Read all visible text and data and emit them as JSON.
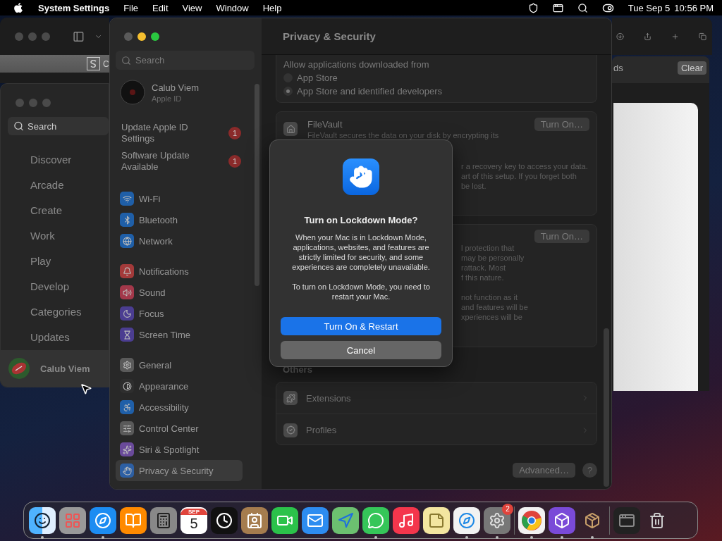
{
  "menu_bar": {
    "app": "System Settings",
    "menus": [
      "File",
      "Edit",
      "View",
      "Window",
      "Help"
    ],
    "date": "Tue Sep 5",
    "time": "10:56 PM"
  },
  "safari": {
    "tab_fragment": "C",
    "downloads": {
      "title_fragment": "ds",
      "clear": "Clear"
    }
  },
  "app_store": {
    "search": {
      "placeholder": "Search"
    },
    "items": [
      "Discover",
      "Arcade",
      "Create",
      "Work",
      "Play",
      "Develop",
      "Categories",
      "Updates"
    ],
    "account": "Calub Viem"
  },
  "settings": {
    "search": {
      "placeholder": "Search"
    },
    "account": {
      "name": "Calub Viem",
      "subtitle": "Apple ID"
    },
    "alerts": [
      {
        "label": "Update Apple ID Settings",
        "badge": "1"
      },
      {
        "label": "Software Update Available",
        "badge": "1"
      }
    ],
    "groups": [
      [
        {
          "label": "Wi-Fi",
          "color": "#1f5fa8",
          "selected": false
        },
        {
          "label": "Bluetooth",
          "color": "#1f5fa8",
          "selected": false
        },
        {
          "label": "Network",
          "color": "#1f5fa8",
          "selected": false
        }
      ],
      [
        {
          "label": "Notifications",
          "color": "#a33a3a",
          "selected": false
        },
        {
          "label": "Sound",
          "color": "#a3384a",
          "selected": false
        },
        {
          "label": "Focus",
          "color": "#4b3d91",
          "selected": false
        },
        {
          "label": "Screen Time",
          "color": "#4b3d91",
          "selected": false
        }
      ],
      [
        {
          "label": "General",
          "color": "#5a5a5a",
          "selected": false
        },
        {
          "label": "Appearance",
          "color": "#2e2e2e",
          "selected": false
        },
        {
          "label": "Accessibility",
          "color": "#1f5fa8",
          "selected": false
        },
        {
          "label": "Control Center",
          "color": "#5a5a5a",
          "selected": false
        },
        {
          "label": "Siri & Spotlight",
          "color": "#6a4a9a",
          "selected": false
        },
        {
          "label": "Privacy & Security",
          "color": "#2d5fa3",
          "selected": true
        }
      ]
    ],
    "title": "Privacy & Security",
    "allow": {
      "heading": "Allow applications downloaded from",
      "options": [
        {
          "label": "App Store",
          "selected": false
        },
        {
          "label": "App Store and identified developers",
          "selected": true
        }
      ]
    },
    "filevault": {
      "title": "FileVault",
      "button": "Turn On…",
      "description": "FileVault secures the data on your disk by encrypting its",
      "fragments": [
        "r a recovery key to access your data.",
        "art of this setup. If you forget both",
        "be lost."
      ]
    },
    "lockdown": {
      "button": "Turn On…",
      "fragment_groups": [
        [
          "l protection that",
          "may be personally",
          "rattack. Most",
          "f this nature."
        ],
        [
          "not function as it",
          "and features will be",
          "xperiences will be"
        ]
      ]
    },
    "others": {
      "heading": "Others",
      "items": [
        {
          "label": "Extensions",
          "kind": "extensions"
        },
        {
          "label": "Profiles",
          "kind": "profiles"
        }
      ]
    },
    "footer": {
      "advanced": "Advanced…",
      "help": "?"
    }
  },
  "dialog": {
    "title": "Turn on Lockdown Mode?",
    "paragraphs": [
      "When your Mac is in Lockdown Mode, applications, websites, and features are strictly limited for security, and some experiences are completely unavailable.",
      "To turn on Lockdown Mode, you need to restart your Mac."
    ],
    "primary": "Turn On & Restart",
    "secondary": "Cancel"
  },
  "dock": {
    "groups": [
      [
        {
          "running": true
        },
        {
          "running": false
        },
        {
          "running": true
        },
        {
          "running": false
        },
        {
          "running": false
        },
        {
          "running": false,
          "month": "SEP",
          "day": "5"
        },
        {
          "running": false
        },
        {
          "running": false
        },
        {
          "running": false
        },
        {
          "running": false
        },
        {
          "running": false
        },
        {
          "running": true
        },
        {
          "running": false
        },
        {
          "running": false
        },
        {
          "running": true
        },
        {
          "running": true,
          "badge": "2"
        }
      ],
      [
        {
          "running": true
        },
        {
          "running": true
        },
        {
          "running": true
        }
      ],
      [
        {
          "running": false
        },
        {
          "running": false
        }
      ]
    ]
  }
}
